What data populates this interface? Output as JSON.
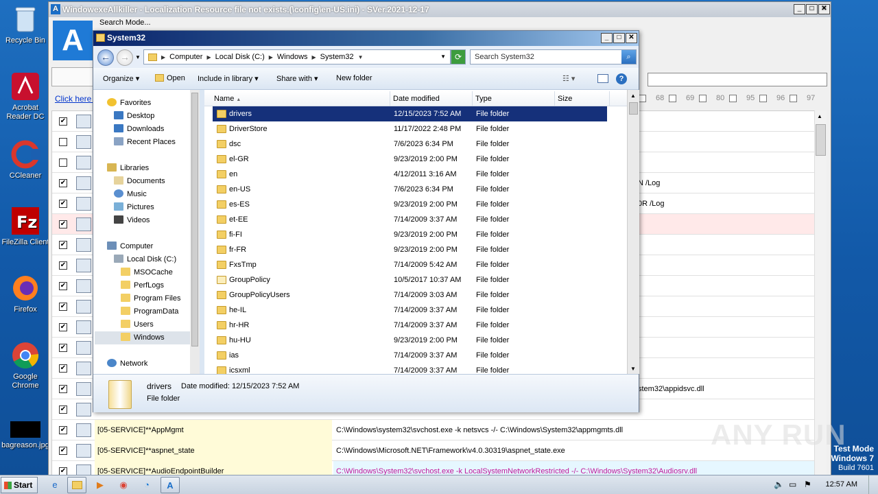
{
  "desktop": {
    "icons": [
      {
        "label": "Recycle Bin",
        "icon": "recycle-bin-icon"
      },
      {
        "label": "Acrobat Reader DC",
        "icon": "acrobat-icon"
      },
      {
        "label": "CCleaner",
        "icon": "ccleaner-icon"
      },
      {
        "label": "FileZilla Client",
        "icon": "filezilla-icon"
      },
      {
        "label": "Firefox",
        "icon": "firefox-icon"
      },
      {
        "label": "Google Chrome",
        "icon": "chrome-icon"
      },
      {
        "label": "bagreason.jpg",
        "icon": "image-file-icon"
      }
    ]
  },
  "bg_app": {
    "title": "WindowexeAllkiller - Localization Resource file not exists.(\\config\\en-US.ini) - SVer.2021-12-17",
    "menu": "Search Mode...",
    "link": "Click here t",
    "number_checks": [
      "68",
      "69",
      "80",
      "95",
      "96",
      "97"
    ],
    "rows": [
      {
        "checked": true,
        "col1": "",
        "col2": ""
      },
      {
        "checked": false,
        "col1": "",
        "col2": ""
      },
      {
        "checked": false,
        "col1": "",
        "col2": ""
      },
      {
        "checked": true,
        "col1": "",
        "col2": "N /Log"
      },
      {
        "checked": true,
        "col1": "",
        "col2": "0R /Log"
      },
      {
        "checked": true,
        "col1": "",
        "col2": ""
      },
      {
        "checked": true,
        "col1": "",
        "col2": ""
      },
      {
        "checked": true,
        "col1": "",
        "col2": ""
      },
      {
        "checked": true,
        "col1": "",
        "col2": ""
      },
      {
        "checked": true,
        "col1": "",
        "col2": ""
      },
      {
        "checked": true,
        "col1": "",
        "col2": ""
      },
      {
        "checked": true,
        "col1": "",
        "col2": ""
      },
      {
        "checked": true,
        "col1": "",
        "col2": ""
      },
      {
        "checked": true,
        "col1": "",
        "col2": "stem32\\appidsvc.dll"
      },
      {
        "checked": true,
        "col1": "",
        "col2": ""
      },
      {
        "checked": true,
        "col1": "[05-SERVICE]**AppMgmt",
        "col2": "C:\\Windows\\system32\\svchost.exe -k netsvcs -/- C:\\Windows\\System32\\appmgmts.dll"
      },
      {
        "checked": true,
        "col1": "[05-SERVICE]**aspnet_state",
        "col2": "C:\\Windows\\Microsoft.NET\\Framework\\v4.0.30319\\aspnet_state.exe"
      },
      {
        "checked": true,
        "col1": "[05-SERVICE]**AudioEndpointBuilder",
        "col2": "C:\\Windows\\System32\\svchost.exe -k LocalSystemNetworkRestricted -/- C:\\Windows\\System32\\Audiosrv.dll"
      }
    ]
  },
  "explorer": {
    "title": "System32",
    "breadcrumb": [
      "Computer",
      "Local Disk (C:)",
      "Windows",
      "System32"
    ],
    "search_placeholder": "Search System32",
    "toolbar": {
      "organize": "Organize",
      "open": "Open",
      "include_in_library": "Include in library",
      "share_with": "Share with",
      "new_folder": "New folder"
    },
    "nav": {
      "favorites": "Favorites",
      "desktop": "Desktop",
      "downloads": "Downloads",
      "recent_places": "Recent Places",
      "libraries": "Libraries",
      "documents": "Documents",
      "music": "Music",
      "pictures": "Pictures",
      "videos": "Videos",
      "computer": "Computer",
      "local_disk": "Local Disk (C:)",
      "msocache": "MSOCache",
      "perflogs": "PerfLogs",
      "program_files": "Program Files",
      "programdata": "ProgramData",
      "users": "Users",
      "windows": "Windows",
      "network": "Network"
    },
    "columns": {
      "name": "Name",
      "date_modified": "Date modified",
      "type": "Type",
      "size": "Size"
    },
    "files": [
      {
        "name": "drivers",
        "date": "12/15/2023 7:52 AM",
        "type": "File folder"
      },
      {
        "name": "DriverStore",
        "date": "11/17/2022 2:48 PM",
        "type": "File folder"
      },
      {
        "name": "dsc",
        "date": "7/6/2023 6:34 PM",
        "type": "File folder"
      },
      {
        "name": "el-GR",
        "date": "9/23/2019 2:00 PM",
        "type": "File folder"
      },
      {
        "name": "en",
        "date": "4/12/2011 3:16 AM",
        "type": "File folder"
      },
      {
        "name": "en-US",
        "date": "7/6/2023 6:34 PM",
        "type": "File folder"
      },
      {
        "name": "es-ES",
        "date": "9/23/2019 2:00 PM",
        "type": "File folder"
      },
      {
        "name": "et-EE",
        "date": "7/14/2009 3:37 AM",
        "type": "File folder"
      },
      {
        "name": "fi-FI",
        "date": "9/23/2019 2:00 PM",
        "type": "File folder"
      },
      {
        "name": "fr-FR",
        "date": "9/23/2019 2:00 PM",
        "type": "File folder"
      },
      {
        "name": "FxsTmp",
        "date": "7/14/2009 5:42 AM",
        "type": "File folder"
      },
      {
        "name": "GroupPolicy",
        "date": "10/5/2017 10:37 AM",
        "type": "File folder"
      },
      {
        "name": "GroupPolicyUsers",
        "date": "7/14/2009 3:03 AM",
        "type": "File folder"
      },
      {
        "name": "he-IL",
        "date": "7/14/2009 3:37 AM",
        "type": "File folder"
      },
      {
        "name": "hr-HR",
        "date": "7/14/2009 3:37 AM",
        "type": "File folder"
      },
      {
        "name": "hu-HU",
        "date": "9/23/2019 2:00 PM",
        "type": "File folder"
      },
      {
        "name": "ias",
        "date": "7/14/2009 3:37 AM",
        "type": "File folder"
      },
      {
        "name": "icsxml",
        "date": "7/14/2009 3:37 AM",
        "type": "File folder"
      }
    ],
    "details": {
      "name": "drivers",
      "date_label": "Date modified:",
      "date_value": "12/15/2023 7:52 AM",
      "type": "File folder"
    }
  },
  "watermark": "ANY RUN",
  "test_mode": {
    "line1": "Test Mode",
    "line2": "Windows 7",
    "line3": "Build 7601"
  },
  "taskbar": {
    "start_label": "Start",
    "clock": "12:57 AM"
  }
}
